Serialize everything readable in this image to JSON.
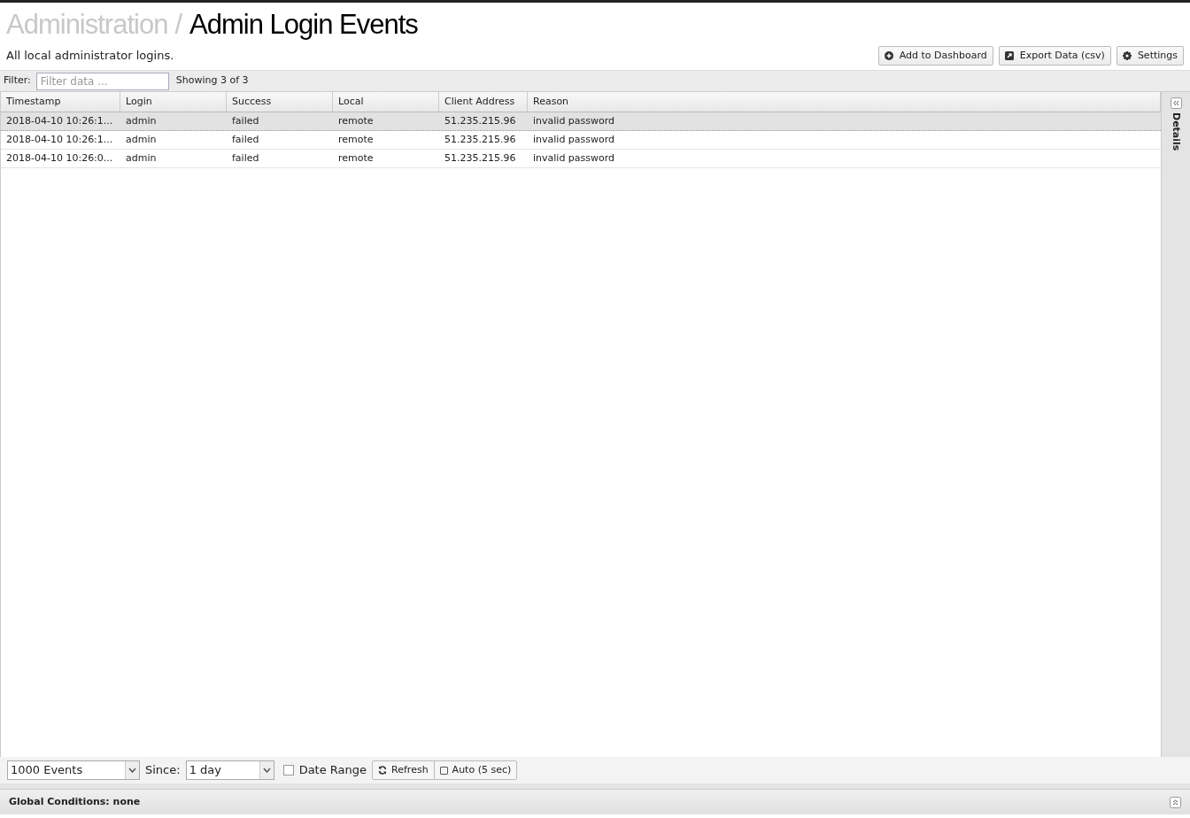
{
  "breadcrumb": {
    "parent": "Administration",
    "separator": "/",
    "title": "Admin Login Events"
  },
  "description": "All local administrator logins.",
  "toolbar_buttons": [
    {
      "kind": "add",
      "label": "Add to Dashboard"
    },
    {
      "kind": "export",
      "label": "Export Data (csv)"
    },
    {
      "kind": "settings",
      "label": "Settings"
    }
  ],
  "filter": {
    "label": "Filter:",
    "placeholder": "Filter data ...",
    "count": "Showing 3 of 3"
  },
  "table": {
    "columns": [
      "Timestamp",
      "Login",
      "Success",
      "Local",
      "Client Address",
      "Reason"
    ],
    "rows": [
      {
        "selected": true,
        "cells": [
          "2018-04-10 10:26:1...",
          "admin",
          "failed",
          "remote",
          "51.235.215.96",
          "invalid password"
        ]
      },
      {
        "selected": false,
        "cells": [
          "2018-04-10 10:26:1...",
          "admin",
          "failed",
          "remote",
          "51.235.215.96",
          "invalid password"
        ]
      },
      {
        "selected": false,
        "cells": [
          "2018-04-10 10:26:0...",
          "admin",
          "failed",
          "remote",
          "51.235.215.96",
          "invalid password"
        ]
      }
    ]
  },
  "details_panel": {
    "label": "Details"
  },
  "bottom_bar": {
    "events": "1000 Events",
    "since_label": "Since:",
    "since": "1 day",
    "date_range": {
      "label": "Date Range",
      "checked": false
    },
    "refresh": "Refresh",
    "auto": {
      "label": "Auto (5 sec)",
      "checked": false
    }
  },
  "global_conditions": "Global Conditions: none"
}
